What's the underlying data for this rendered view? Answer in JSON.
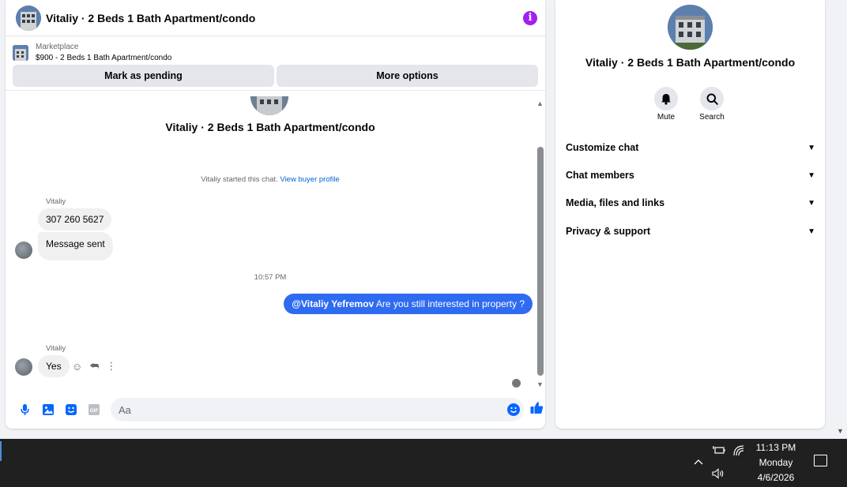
{
  "chat": {
    "header_title": "Vitaliy · 2 Beds 1 Bath Apartment/condo",
    "marketplace_label": "Marketplace",
    "listing_text": "$900 - 2 Beds 1 Bath Apartment/condo",
    "mark_pending_label": "Mark as pending",
    "more_options_label": "More options",
    "messages_title": "Vitaliy · 2 Beds 1 Bath Apartment/condo",
    "started_text": "Vitaliy started this chat.",
    "view_buyer_profile": "View buyer profile",
    "sender_name": "Vitaliy",
    "msg_phone": "307 260 5627",
    "msg_sent": "Message sent",
    "timestamp": "10:57 PM",
    "out_mention": "@Vitaliy Yefremov",
    "out_text": " Are you still interested in property ?",
    "sender_name_2": "Vitaliy",
    "msg_yes": "Yes",
    "composer_placeholder": "Aa"
  },
  "info": {
    "title": "Vitaliy · 2 Beds 1 Bath Apartment/condo",
    "mute_label": "Mute",
    "search_label": "Search",
    "sections": [
      "Customize chat",
      "Chat members",
      "Media, files and links",
      "Privacy & support"
    ]
  },
  "taskbar": {
    "time": "11:13 PM",
    "day": "Monday",
    "date": "4/6/2026"
  },
  "colors": {
    "accent": "#0866ff",
    "outgoing_bubble": "#2e6bf1",
    "info_icon": "#a020f0"
  }
}
